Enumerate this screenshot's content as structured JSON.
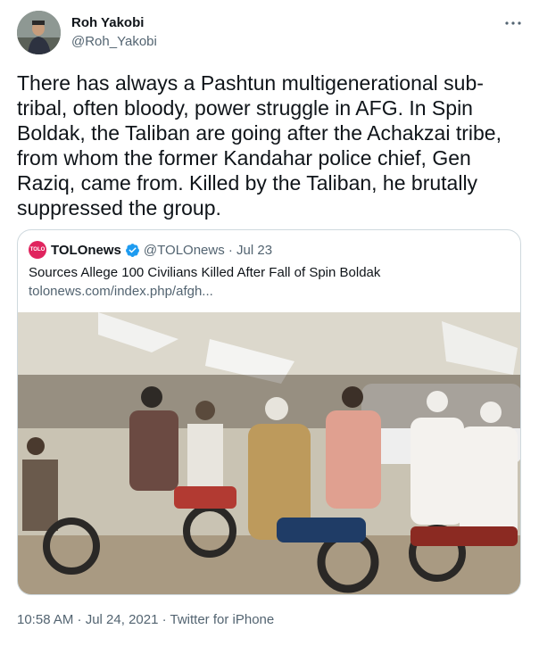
{
  "author": {
    "name": "Roh Yakobi",
    "handle": "@Roh_Yakobi"
  },
  "tweet_text": "There has always a Pashtun multigenerational sub-tribal, often bloody, power struggle in AFG. In Spin Boldak, the Taliban are going after the Achakzai tribe, from whom the former Kandahar police chief, Gen Raziq, came from. Killed by the Taliban, he brutally suppressed the group.",
  "quoted": {
    "avatar_text": "TOLO",
    "name": "TOLOnews",
    "handle_date": "@TOLOnews · Jul 23",
    "title": "Sources Allege 100 Civilians Killed After Fall of Spin Boldak",
    "url": "tolonews.com/index.php/afgh...",
    "verified_color": "#1d9bf0",
    "avatar_color": "#e0245e"
  },
  "footer": "10:58 AM · Jul 24, 2021 · Twitter for iPhone",
  "icons": [
    "more-options-icon",
    "verified-badge-icon"
  ]
}
